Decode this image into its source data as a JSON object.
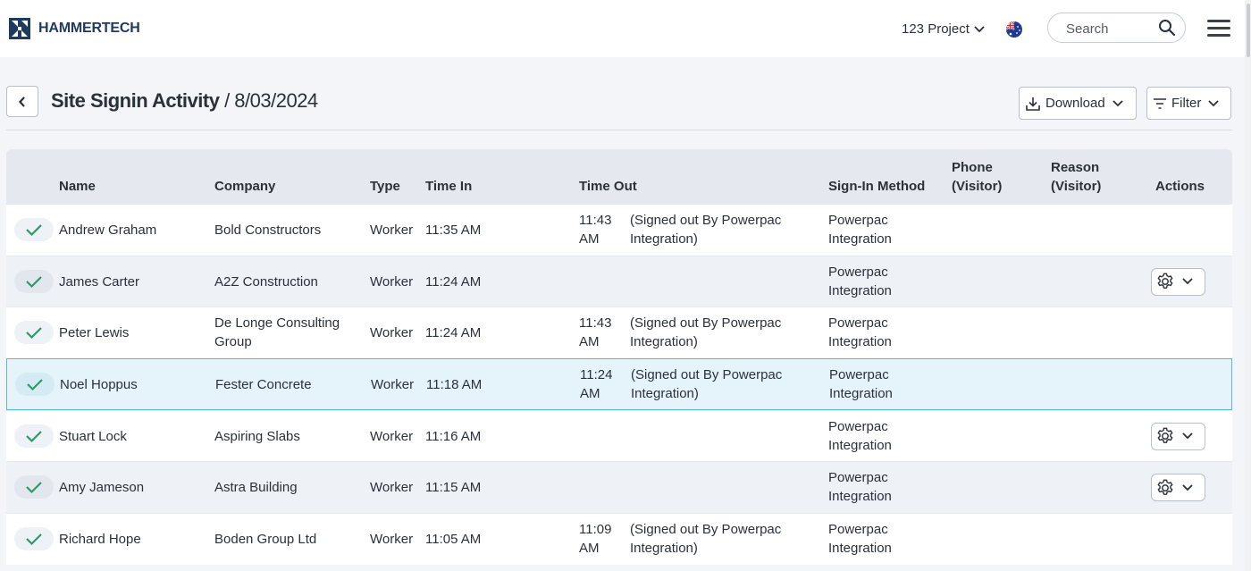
{
  "brand": {
    "name": "HAMMERTECH"
  },
  "topbar": {
    "project_label": "123 Project",
    "search_placeholder": "Search",
    "flag": "australia-flag"
  },
  "header": {
    "title": "Site Signin Activity",
    "separator": " / ",
    "date": "8/03/2024",
    "download_label": "Download",
    "filter_label": "Filter"
  },
  "columns": {
    "name": "Name",
    "company": "Company",
    "type": "Type",
    "time_in": "Time In",
    "time_out": "Time Out",
    "method": "Sign-In Method",
    "phone_1": "Phone",
    "phone_2": "(Visitor)",
    "reason_1": "Reason",
    "reason_2": "(Visitor)",
    "actions": "Actions"
  },
  "rows": [
    {
      "name": "Andrew Graham",
      "company_1": "Bold Constructors",
      "company_2": "",
      "type": "Worker",
      "time_in": "11:35 AM",
      "out_1": "11:43",
      "out_2": "AM",
      "note_1": "(Signed out By Powerpac",
      "note_2": "Integration)",
      "method_1": "Powerpac",
      "method_2": "Integration",
      "actions": false
    },
    {
      "name": "James Carter",
      "company_1": "A2Z Construction",
      "company_2": "",
      "type": "Worker",
      "time_in": "11:24 AM",
      "out_1": "",
      "out_2": "",
      "note_1": "",
      "note_2": "",
      "method_1": "Powerpac",
      "method_2": "Integration",
      "actions": true
    },
    {
      "name": "Peter Lewis",
      "company_1": "De Longe Consulting",
      "company_2": "Group",
      "type": "Worker",
      "time_in": "11:24 AM",
      "out_1": "11:43",
      "out_2": "AM",
      "note_1": "(Signed out By Powerpac",
      "note_2": "Integration)",
      "method_1": "Powerpac",
      "method_2": "Integration",
      "actions": false
    },
    {
      "name": "Noel Hoppus",
      "company_1": "Fester Concrete",
      "company_2": "",
      "type": "Worker",
      "time_in": "11:18 AM",
      "out_1": "11:24",
      "out_2": "AM",
      "note_1": "(Signed out By Powerpac",
      "note_2": "Integration)",
      "method_1": "Powerpac",
      "method_2": "Integration",
      "actions": false
    },
    {
      "name": "Stuart Lock",
      "company_1": "Aspiring Slabs",
      "company_2": "",
      "type": "Worker",
      "time_in": "11:16 AM",
      "out_1": "",
      "out_2": "",
      "note_1": "",
      "note_2": "",
      "method_1": "Powerpac",
      "method_2": "Integration",
      "actions": true
    },
    {
      "name": "Amy Jameson",
      "company_1": "Astra Building",
      "company_2": "",
      "type": "Worker",
      "time_in": "11:15 AM",
      "out_1": "",
      "out_2": "",
      "note_1": "",
      "note_2": "",
      "method_1": "Powerpac",
      "method_2": "Integration",
      "actions": true
    },
    {
      "name": "Richard Hope",
      "company_1": "Boden Group Ltd",
      "company_2": "",
      "type": "Worker",
      "time_in": "11:05 AM",
      "out_1": "11:09",
      "out_2": "AM",
      "note_1": "(Signed out By Powerpac",
      "note_2": "Integration)",
      "method_1": "Powerpac",
      "method_2": "Integration",
      "actions": false
    }
  ],
  "colors": {
    "accent_check": "#2e9a6a",
    "brand": "#1e3a5f",
    "selected_border": "#59b7d8"
  }
}
